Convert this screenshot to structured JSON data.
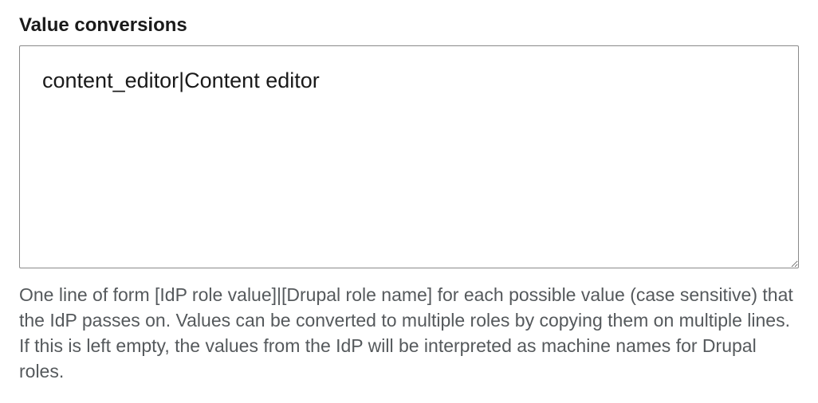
{
  "form": {
    "value_conversions": {
      "label": "Value conversions",
      "value": "content_editor|Content editor",
      "description": "One line of form [IdP role value]|[Drupal role name] for each possible value (case sensitive) that the IdP passes on. Values can be converted to multiple roles by copying them on multiple lines. If this is left empty, the values from the IdP will be interpreted as machine names for Drupal roles."
    }
  }
}
